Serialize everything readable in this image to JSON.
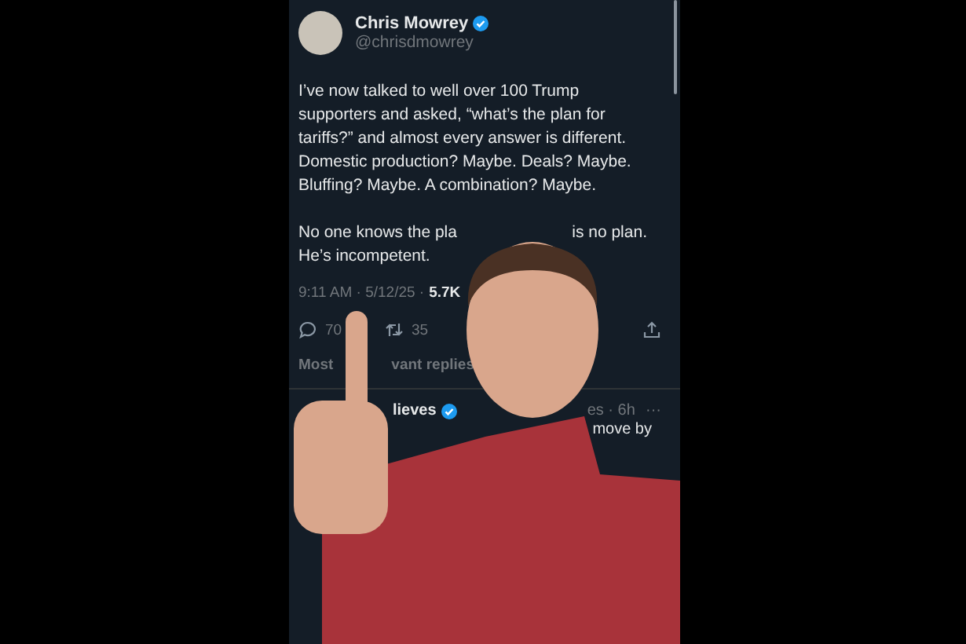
{
  "tweet": {
    "author": {
      "name": "Chris Mowrey",
      "verified": true,
      "handle": "@chrisdmowrey"
    },
    "paragraphs": [
      "I’ve now talked to well over 100 Trump supporters and asked, “what’s the plan for tariffs?” and almost every answer is different. Domestic production? Maybe. Deals? Maybe. Bluffing? Maybe. A combination? Maybe."
    ],
    "partial_line": [
      "No one knows the pla",
      "is no plan."
    ],
    "last_line": "He’s incompetent.",
    "meta": {
      "time": "9:11 AM · 5/12/25 ·",
      "views": "5.7K"
    },
    "actions": {
      "replies": "70",
      "reposts": "35"
    },
    "sort": {
      "left": "Most",
      "right": "vant replies"
    },
    "reply": {
      "name": "lieves",
      "verified": true,
      "time": "es · 6h",
      "more": "···",
      "text": "move by"
    }
  }
}
